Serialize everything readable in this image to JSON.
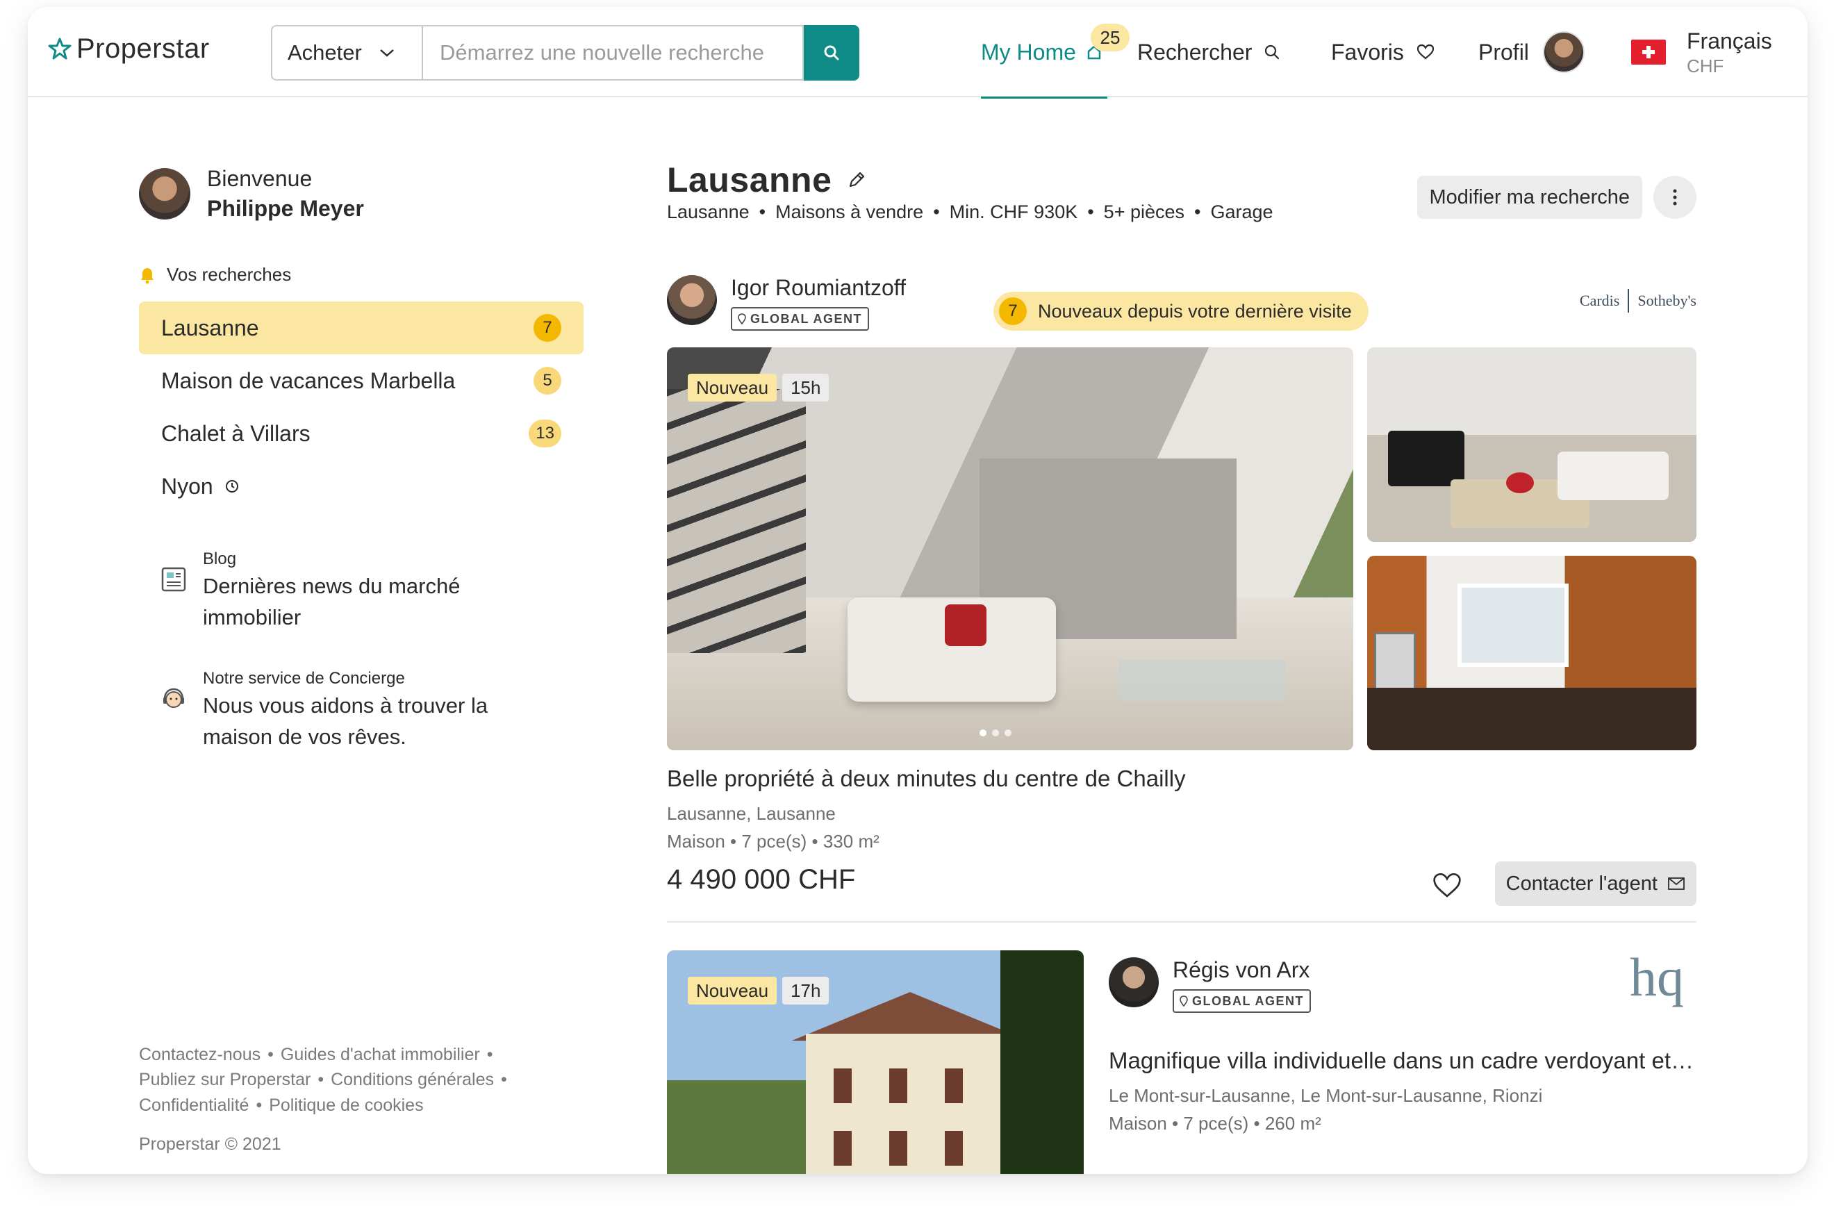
{
  "header": {
    "logo_text": "Properstar",
    "search_mode": "Acheter",
    "search_placeholder": "Démarrez une nouvelle recherche",
    "nav": {
      "my_home": "My Home",
      "my_home_count": "25",
      "search": "Rechercher",
      "favorites": "Favoris",
      "profile": "Profil",
      "language": "Français",
      "currency": "CHF"
    }
  },
  "sidebar": {
    "welcome": "Bienvenue",
    "user_name": "Philippe Meyer",
    "section_title": "Vos recherches",
    "searches": [
      {
        "label": "Lausanne",
        "count": "7",
        "active": true
      },
      {
        "label": "Maison de vacances Marbella",
        "count": "5"
      },
      {
        "label": "Chalet à Villars",
        "count": "13"
      },
      {
        "label": "Nyon",
        "count": ""
      }
    ],
    "blog": {
      "kicker": "Blog",
      "title": "Dernières news du marché immobilier"
    },
    "concierge": {
      "kicker": "Notre service de Concierge",
      "title": "Nous vous aidons à trouver la maison de vos rêves."
    },
    "footer": {
      "links": [
        "Contactez-nous",
        "Guides d'achat immobilier",
        "Publiez sur Properstar",
        "Conditions générales",
        "Confidentialité",
        "Politique de cookies"
      ],
      "copyright": "Properstar © 2021"
    }
  },
  "main": {
    "title": "Lausanne",
    "criteria": [
      "Lausanne",
      "Maisons à vendre",
      "Min. CHF 930K",
      "5+ pièces",
      "Garage"
    ],
    "modify_button": "Modifier ma recherche",
    "listing1": {
      "agent_name": "Igor Roumiantzoff",
      "agent_badge": "GLOBAL AGENT",
      "new_count": "7",
      "new_text": "Nouveaux depuis votre dernière visite",
      "brand_left": "Cardis",
      "brand_right": "Sotheby's",
      "tag_new": "Nouveau",
      "tag_time": "15h",
      "title": "Belle propriété à deux minutes du centre de Chailly",
      "location": "Lausanne, Lausanne",
      "meta": "Maison • 7 pce(s) • 330 m²",
      "price": "4 490 000 CHF",
      "contact_button": "Contacter l'agent"
    },
    "listing2": {
      "agent_name": "Régis von Arx",
      "agent_badge": "GLOBAL AGENT",
      "brand_logo": "hq",
      "tag_new": "Nouveau",
      "tag_time": "17h",
      "title": "Magnifique villa individuelle dans un cadre verdoyant et …",
      "location": "Le Mont-sur-Lausanne, Le Mont-sur-Lausanne, Rionzi",
      "meta": "Maison • 7 pce(s) • 260 m²"
    }
  },
  "colors": {
    "brand": "#0e8a87",
    "highlight": "#fbe6a2",
    "badge": "#f5b800",
    "flag": "#e5202e"
  }
}
